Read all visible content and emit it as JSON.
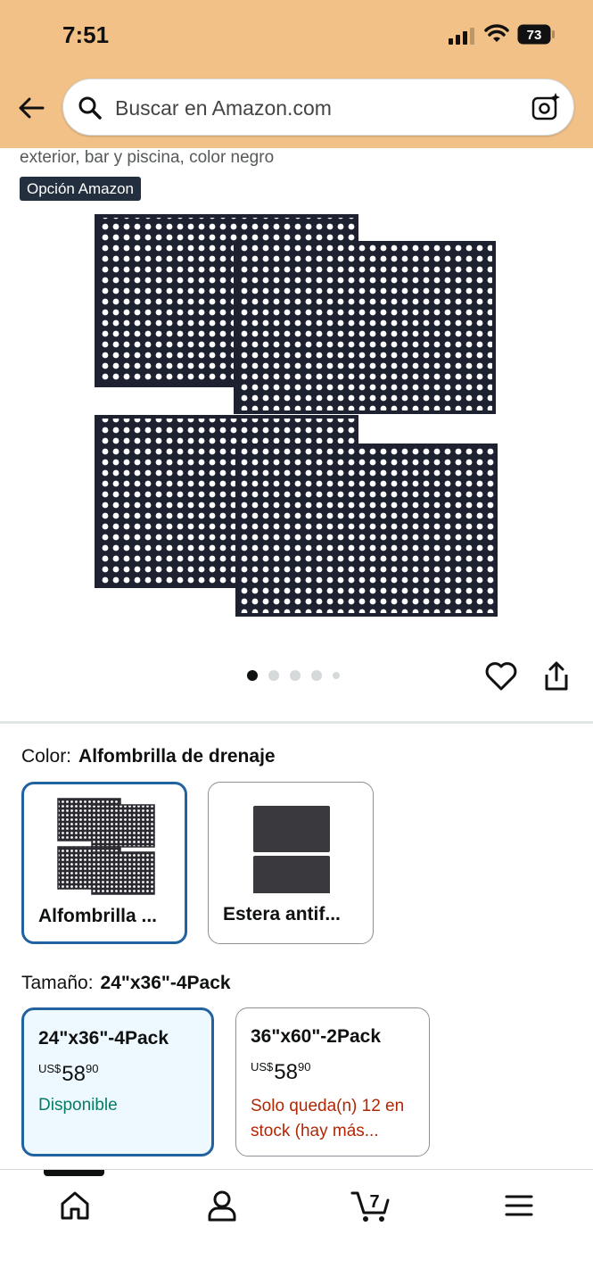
{
  "status_bar": {
    "time": "7:51",
    "battery": "73"
  },
  "search": {
    "placeholder": "Buscar en Amazon.com"
  },
  "product": {
    "title_fragment": "exterior, bar y piscina, color negro",
    "badge": "Opción Amazon",
    "image_dots": 5,
    "active_dot": 0
  },
  "color_selector": {
    "label": "Color:",
    "selected_value": "Alfombrilla de drenaje",
    "options": [
      {
        "name": "Alfombrilla ...",
        "selected": true
      },
      {
        "name": "Estera antif...",
        "selected": false
      }
    ]
  },
  "size_selector": {
    "label": "Tamaño:",
    "selected_value": "24\"x36\"-4Pack",
    "options": [
      {
        "name": "24\"x36\"-4Pack",
        "currency": "US$",
        "price_whole": "58",
        "price_cents": "90",
        "availability": "Disponible",
        "selected": true
      },
      {
        "name": "36\"x60\"-2Pack",
        "currency": "US$",
        "price_whole": "58",
        "price_cents": "90",
        "availability": "Solo queda(n) 12 en stock (hay más...",
        "selected": false
      }
    ]
  },
  "tab_bar": {
    "items": [
      "home-icon",
      "account-icon",
      "cart-icon",
      "menu-icon"
    ],
    "cart_count": "7"
  },
  "colors": {
    "header_bg": "#f2c187",
    "selected_border": "#2162a1",
    "available_green": "#067d62",
    "stock_red": "#b12704",
    "badge_bg": "#232f3e"
  }
}
